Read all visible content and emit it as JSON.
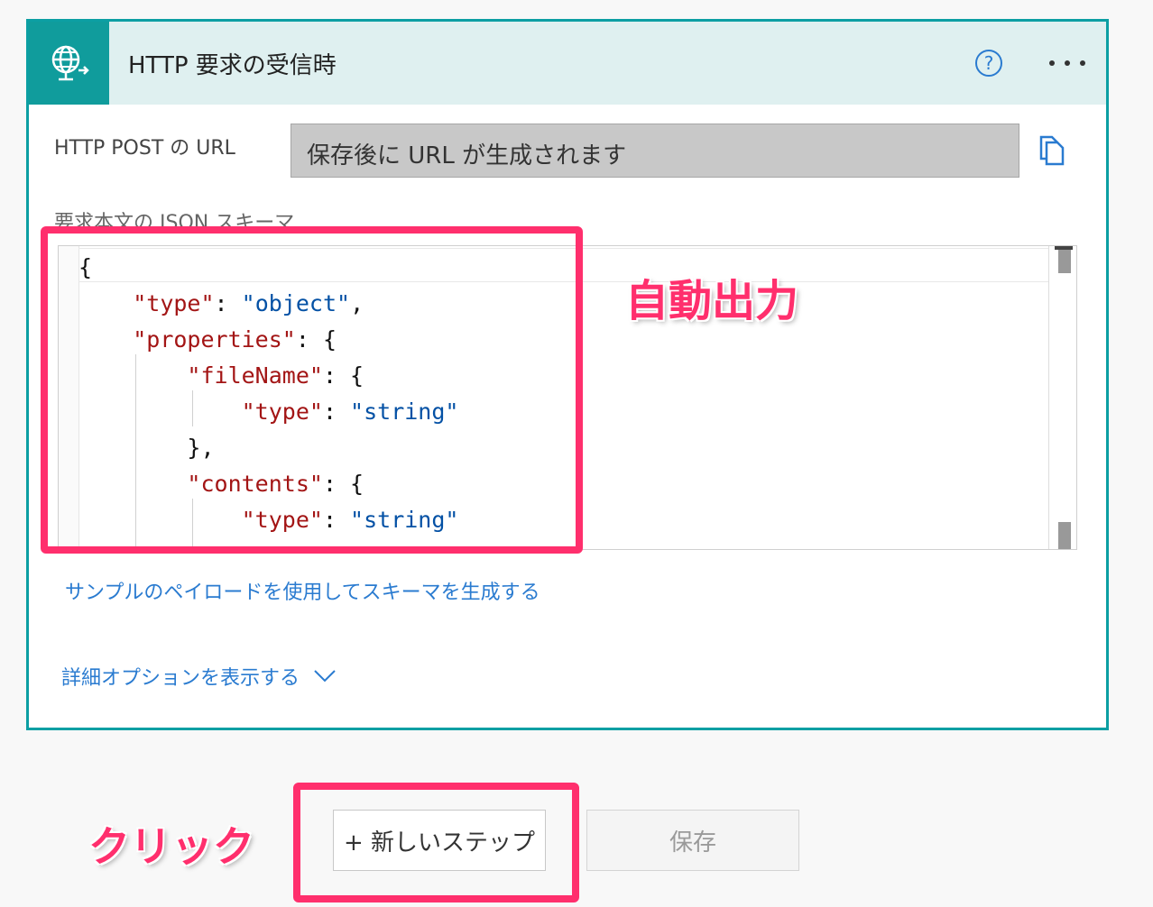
{
  "trigger": {
    "title": "HTTP 要求の受信時",
    "icon": "globe-request-icon",
    "help_icon": "help-icon",
    "more_icon": "more-icon"
  },
  "url": {
    "label": "HTTP POST の URL",
    "value": "保存後に URL が生成されます",
    "copy_icon": "copy-icon"
  },
  "schema": {
    "label": "要求本文の JSON スキーマ",
    "lines": [
      "{",
      "    \"type\": \"object\",",
      "    \"properties\": {",
      "        \"fileName\": {",
      "            \"type\": \"string\"",
      "        },",
      "        \"contents\": {",
      "            \"type\": \"string\"",
      "        }"
    ]
  },
  "links": {
    "sample": "サンプルのペイロードを使用してスキーマを生成する",
    "advanced": "詳細オプションを表示する"
  },
  "buttons": {
    "new_step": "+ 新しいステップ",
    "save": "保存"
  },
  "annotations": {
    "auto_output": "自動出力",
    "click": "クリック",
    "color": "#ff2f6d"
  },
  "colors": {
    "accent": "#0c9fa3",
    "header_bg": "#dff0f0",
    "link": "#2a7bd0"
  }
}
